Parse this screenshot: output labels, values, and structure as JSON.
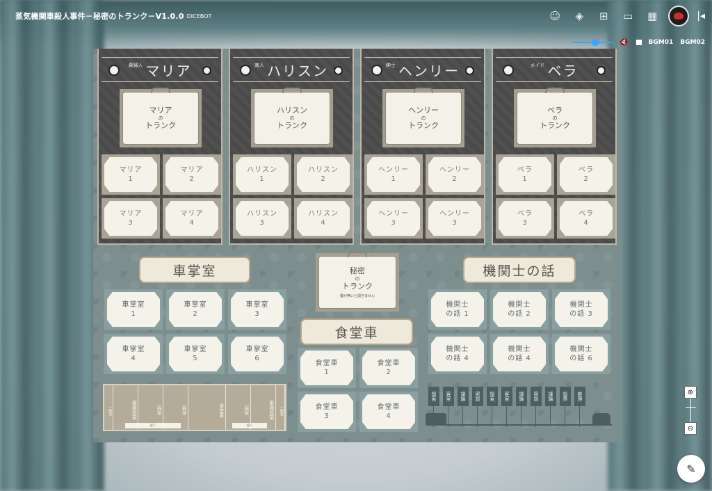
{
  "topbar": {
    "room_title": "蒸気機関車殺人事件－秘密のトランク－V1.0.0",
    "dicebot": "DICEBOT",
    "icons": [
      "face-icon",
      "layers-icon",
      "add-box-icon",
      "screen-icon",
      "clapper-icon",
      "avatar-icon",
      "collapse-icon"
    ]
  },
  "audio": {
    "bgm1": "BGM01",
    "bgm2": "BGM02",
    "volume": 0.5
  },
  "characters": [
    {
      "role": "貴婦人",
      "name": "マリア",
      "trunk": [
        "マリア",
        "の",
        "トランク"
      ],
      "cards": [
        [
          "マリア",
          "1"
        ],
        [
          "マリア",
          "2"
        ],
        [
          "マリア",
          "3"
        ],
        [
          "マリア",
          "4"
        ]
      ]
    },
    {
      "role": "商人",
      "name": "ハリスン",
      "trunk": [
        "ハリスン",
        "の",
        "トランク"
      ],
      "cards": [
        [
          "ハリスン",
          "1"
        ],
        [
          "ハリスン",
          "2"
        ],
        [
          "ハリスン",
          "3"
        ],
        [
          "ハリスン",
          "4"
        ]
      ]
    },
    {
      "role": "紳士",
      "name": "ヘンリー",
      "trunk": [
        "ヘンリー",
        "の",
        "トランク"
      ],
      "cards": [
        [
          "ヘンリー",
          "1"
        ],
        [
          "ヘンリー",
          "2"
        ],
        [
          "ヘンリー",
          "3"
        ],
        [
          "ヘンリー",
          "3"
        ]
      ]
    },
    {
      "role": "メイド",
      "name": "ベラ",
      "trunk": [
        "ベラ",
        "の",
        "トランク"
      ],
      "cards": [
        [
          "ベラ",
          "1"
        ],
        [
          "ベラ",
          "2"
        ],
        [
          "ベラ",
          "3"
        ],
        [
          "ベラ",
          "4"
        ]
      ]
    }
  ],
  "secret_trunk": {
    "lines": [
      "秘密",
      "の",
      "トランク"
    ],
    "note": "鍵が無いと開きません"
  },
  "sections": {
    "conductor": {
      "title": "車掌室",
      "cards": [
        [
          "車掌室",
          "1"
        ],
        [
          "車掌室",
          "2"
        ],
        [
          "車掌室",
          "3"
        ],
        [
          "車掌室",
          "4"
        ],
        [
          "車掌室",
          "5"
        ],
        [
          "車掌室",
          "6"
        ]
      ]
    },
    "dining": {
      "title": "食堂車",
      "cards": [
        [
          "食堂車",
          "1"
        ],
        [
          "食堂車",
          "2"
        ],
        [
          "食堂車",
          "3"
        ],
        [
          "食堂車",
          "4"
        ]
      ]
    },
    "engineer": {
      "title": "機関士の話",
      "cards": [
        [
          "機関士",
          "の話 1"
        ],
        [
          "機関士",
          "の話 2"
        ],
        [
          "機関士",
          "の話 3"
        ],
        [
          "機関士",
          "の話 4"
        ],
        [
          "機関士",
          "の話 4"
        ],
        [
          "機関士",
          "の話 6"
        ]
      ]
    }
  },
  "floorplan": {
    "cells": [
      "一般室",
      "乗務員室",
      "客室",
      "客室",
      "食堂車",
      "客室",
      "乗務員室",
      "一般室"
    ],
    "corridor": "廊下"
  },
  "flags": [
    "探索",
    "客室",
    "議論",
    "密談",
    "探索",
    "客室",
    "議論",
    "密談",
    "議論",
    "投票",
    "推理"
  ]
}
